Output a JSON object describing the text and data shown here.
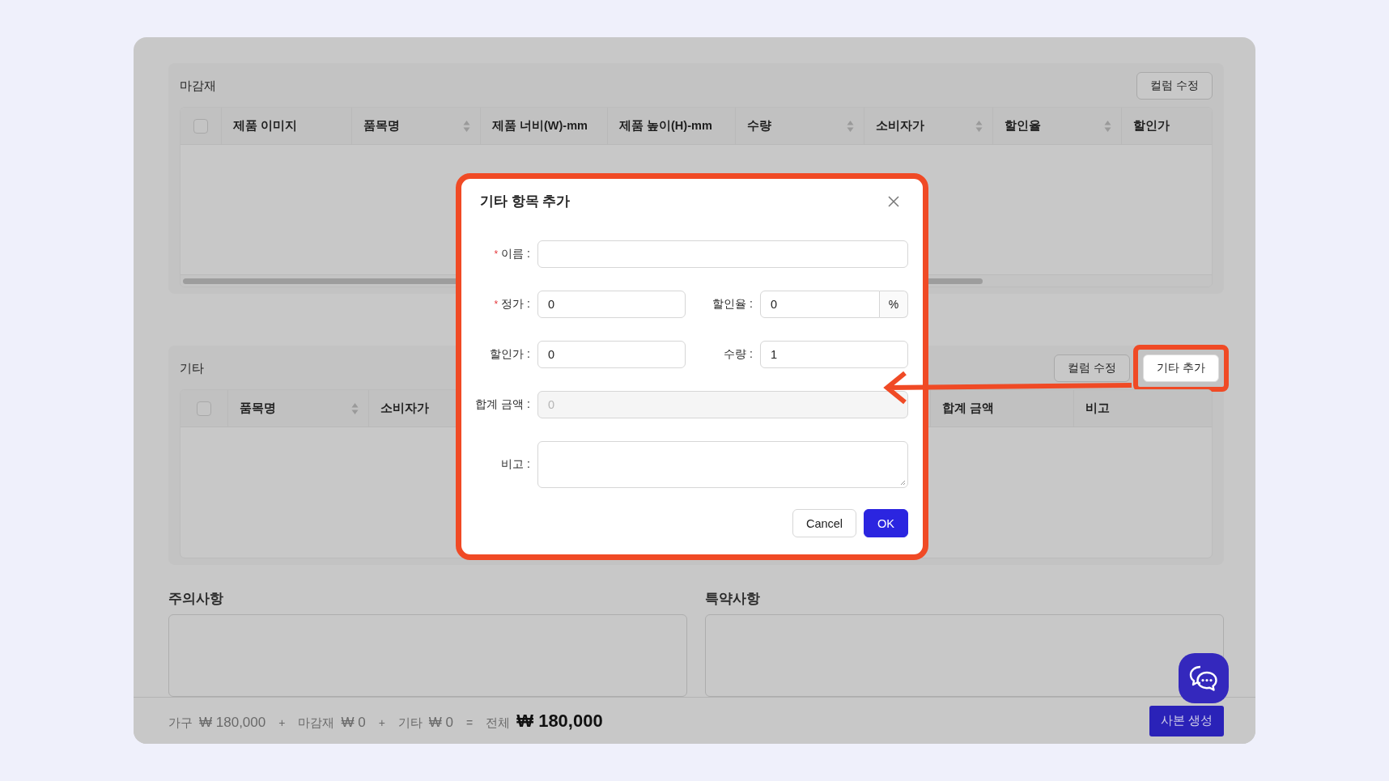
{
  "sections": [
    {
      "title": "마감재",
      "scrollable": true,
      "all_selected": false,
      "buttons": [
        {
          "label": "컬럼 수정",
          "highlighted": false
        }
      ],
      "columns": [
        {
          "label": "제품 이미지",
          "sortable": false
        },
        {
          "label": "품목명",
          "sortable": true
        },
        {
          "label": "제품 너비(W)-mm",
          "sortable": false
        },
        {
          "label": "제품 높이(H)-mm",
          "sortable": false
        },
        {
          "label": "수량",
          "sortable": true
        },
        {
          "label": "소비자가",
          "sortable": true
        },
        {
          "label": "할인율",
          "sortable": true
        },
        {
          "label": "할인가",
          "sortable": false
        }
      ]
    },
    {
      "title": "기타",
      "scrollable": false,
      "all_selected": false,
      "buttons": [
        {
          "label": "컬럼 수정",
          "highlighted": false
        },
        {
          "label": "기타 추가",
          "highlighted": true
        }
      ],
      "columns": [
        {
          "label": "품목명",
          "sortable": true
        },
        {
          "label": "소비자가"
        },
        {
          "label": "합계 금액",
          "sortable": false
        },
        {
          "label": "비고",
          "sortable": false
        }
      ]
    }
  ],
  "notes": [
    {
      "title": "주의사항"
    },
    {
      "title": "특약사항"
    }
  ],
  "summary": {
    "parts": [
      {
        "label": "가구",
        "amount": "₩ 180,000"
      },
      {
        "label": "마감재",
        "amount": "₩ 0"
      },
      {
        "label": "기타",
        "amount": "₩ 0"
      }
    ],
    "operators": [
      "+",
      "+",
      "="
    ],
    "total": {
      "label": "전체",
      "amount": "₩ 180,000"
    }
  },
  "primary_button": "사본 생성",
  "dialog": {
    "title": "기타 항목 추가",
    "rows": [
      [
        {
          "label": "이름 :",
          "required_mark": "*",
          "kind": "text"
        }
      ],
      [
        {
          "label": "정가 :",
          "required_mark": "*",
          "kind": "text",
          "value": "0"
        },
        {
          "label": "할인율 :",
          "kind": "addon",
          "value": "0",
          "suffix": "%"
        }
      ],
      [
        {
          "label": "할인가 :",
          "kind": "text",
          "value": "0"
        },
        {
          "label": "수량 :",
          "kind": "text",
          "value": "1"
        }
      ],
      [
        {
          "label": "합계 금액 :",
          "kind": "text",
          "value": "0",
          "disabled": true
        }
      ],
      [
        {
          "label": "비고 :",
          "kind": "textarea"
        }
      ]
    ],
    "buttons": [
      {
        "label": "Cancel",
        "primary": false
      },
      {
        "label": "OK",
        "primary": true
      }
    ]
  }
}
